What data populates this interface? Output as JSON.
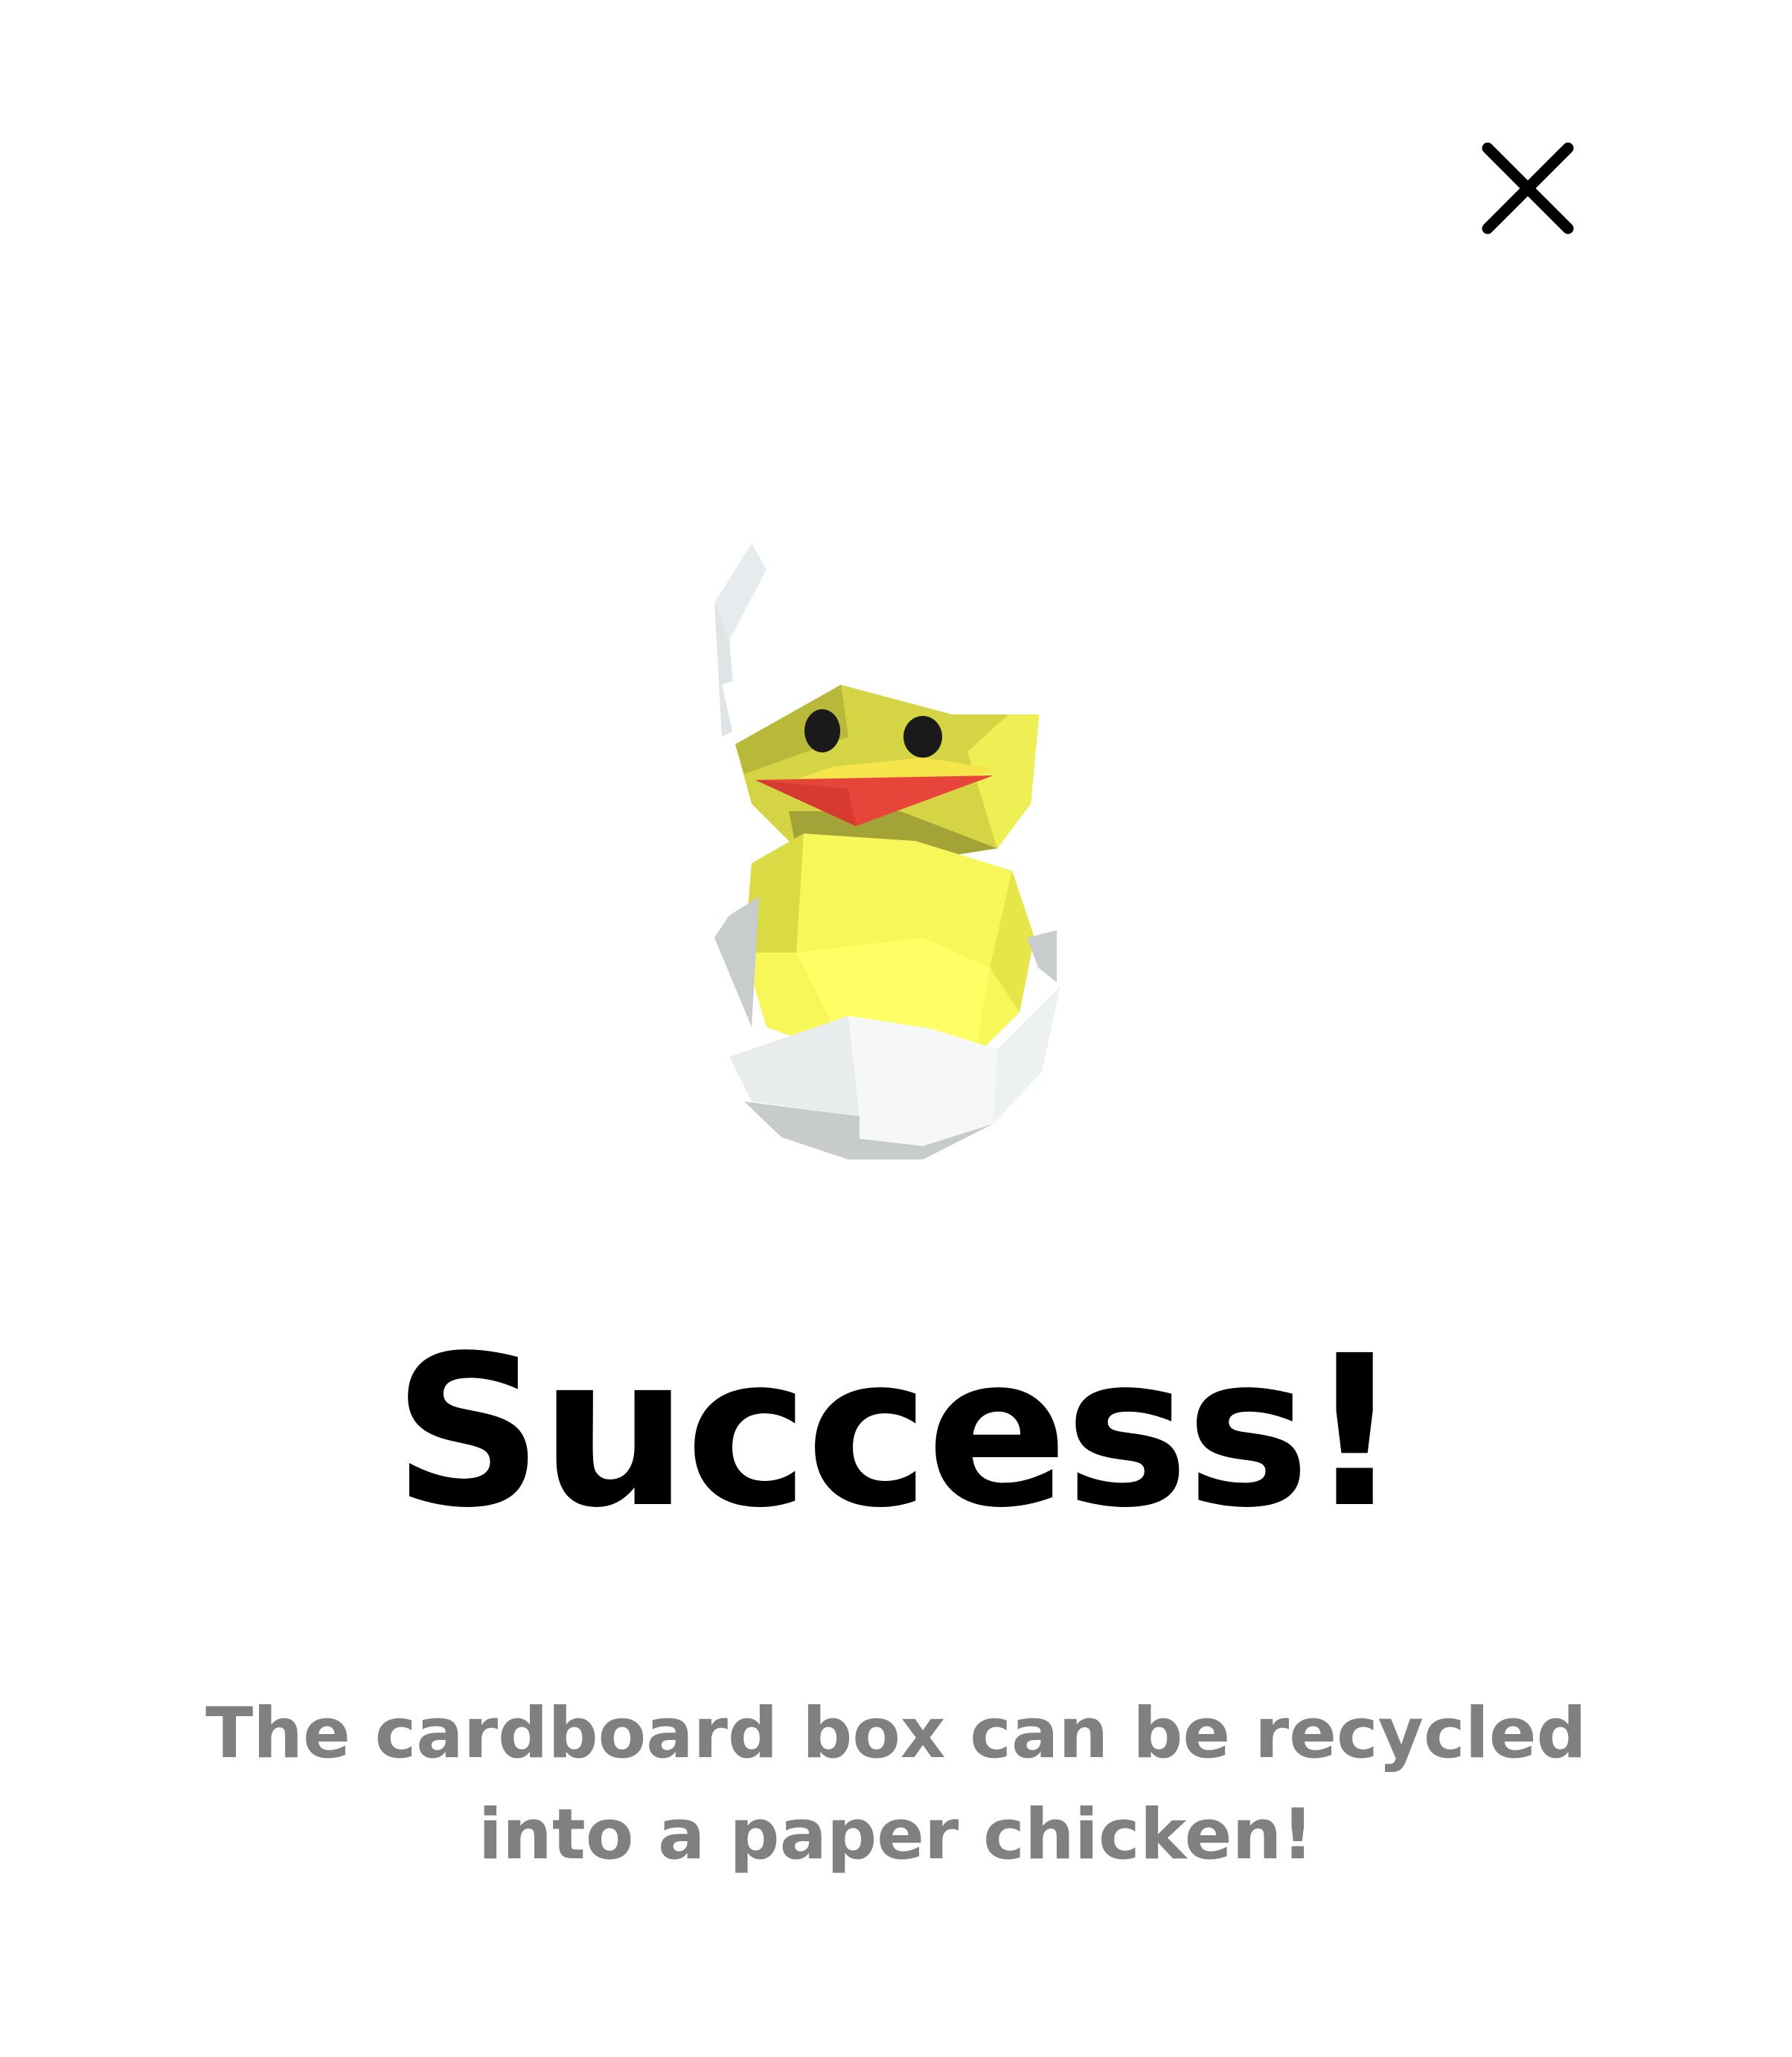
{
  "dialog": {
    "close_icon": "close-icon",
    "illustration": "hatching-chick-icon",
    "title": "Success!",
    "message": "The cardboard box can be recycled into a paper chicken!",
    "colors": {
      "background": "#ffffff",
      "title": "#000000",
      "message": "#808080",
      "chick": "#f2f24a",
      "beak": "#e8453a",
      "eggshell": "#eef2f2"
    }
  }
}
